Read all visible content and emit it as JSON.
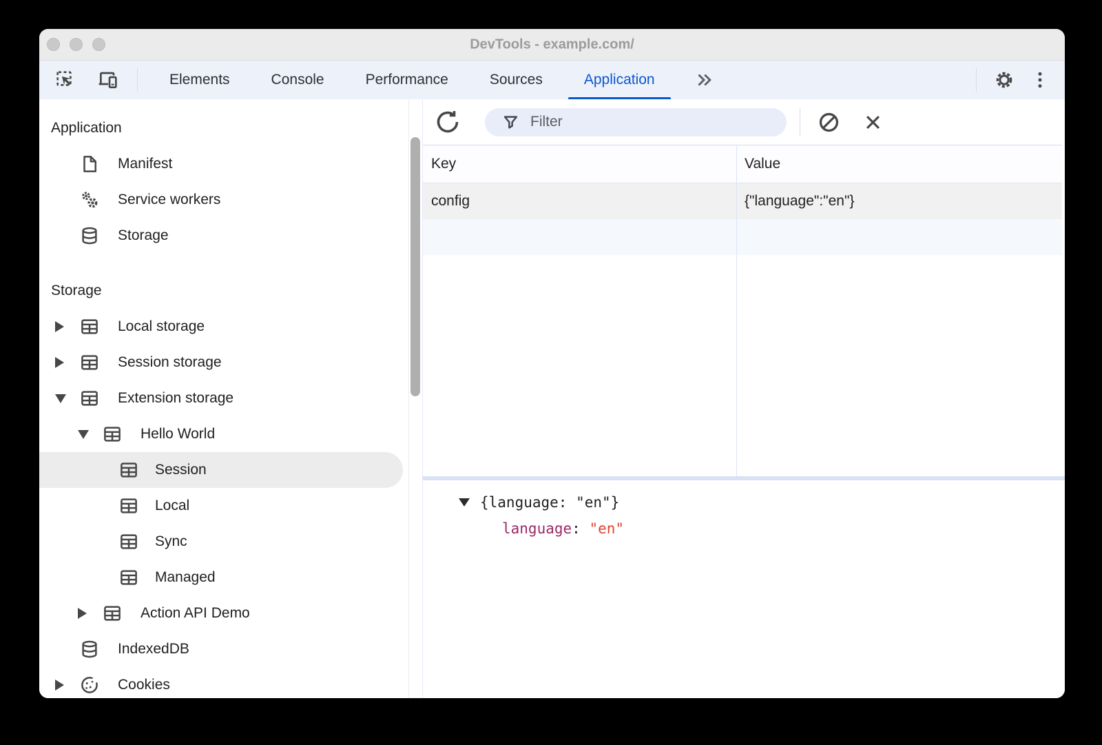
{
  "window": {
    "title": "DevTools - example.com/",
    "traffic_lights": [
      "close",
      "minimize",
      "zoom"
    ]
  },
  "tabbar": {
    "tabs": [
      {
        "label": "Elements",
        "active": false
      },
      {
        "label": "Console",
        "active": false
      },
      {
        "label": "Performance",
        "active": false
      },
      {
        "label": "Sources",
        "active": false
      },
      {
        "label": "Application",
        "active": true
      }
    ]
  },
  "sidebar": {
    "sections": [
      {
        "header": "Application",
        "items": [
          {
            "label": "Manifest",
            "icon": "document-icon"
          },
          {
            "label": "Service workers",
            "icon": "gears-icon"
          },
          {
            "label": "Storage",
            "icon": "database-icon"
          }
        ]
      },
      {
        "header": "Storage",
        "items": [
          {
            "label": "Local storage",
            "icon": "table-icon",
            "state": "collapsed"
          },
          {
            "label": "Session storage",
            "icon": "table-icon",
            "state": "collapsed"
          },
          {
            "label": "Extension storage",
            "icon": "table-icon",
            "state": "expanded"
          },
          {
            "label": "Hello World",
            "icon": "table-icon",
            "state": "expanded"
          },
          {
            "label": "Session",
            "icon": "table-icon",
            "selected": true
          },
          {
            "label": "Local",
            "icon": "table-icon"
          },
          {
            "label": "Sync",
            "icon": "table-icon"
          },
          {
            "label": "Managed",
            "icon": "table-icon"
          },
          {
            "label": "Action API Demo",
            "icon": "table-icon",
            "state": "collapsed"
          },
          {
            "label": "IndexedDB",
            "icon": "database-icon"
          },
          {
            "label": "Cookies",
            "icon": "cookie-icon",
            "state": "collapsed"
          }
        ]
      }
    ]
  },
  "panel": {
    "toolbar": {
      "filter_placeholder": "Filter"
    },
    "table": {
      "columns": [
        "Key",
        "Value"
      ],
      "rows": [
        {
          "key": "config",
          "value": "{\"language\":\"en\"}"
        }
      ]
    },
    "preview": {
      "root_line": "{language: \"en\"}",
      "property": "language",
      "separator": ": ",
      "value": "\"en\""
    }
  },
  "colors": {
    "accent": "#0b57d0",
    "tabbar_bg": "#edf1fa",
    "selected_row": "#f1f1f1",
    "preview_key": "#9c2767",
    "preview_string": "#de4331"
  }
}
